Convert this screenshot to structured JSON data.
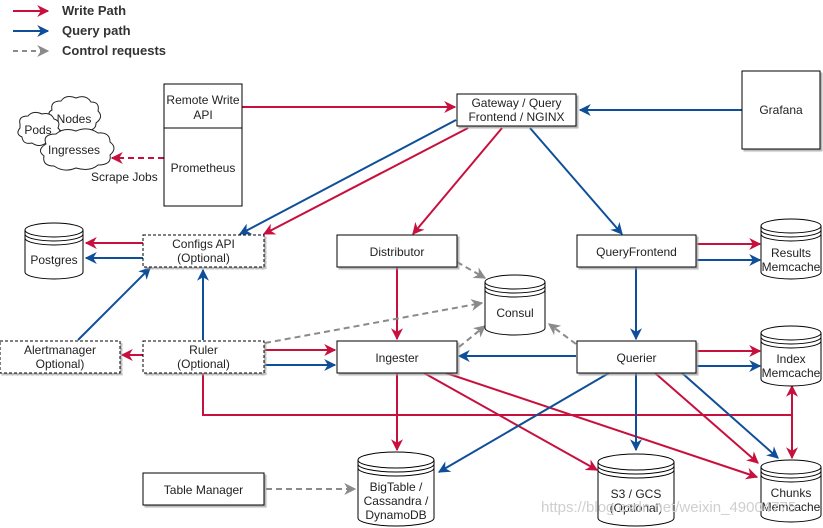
{
  "colors": {
    "write": "#c8103e",
    "query": "#0f4f99",
    "control": "#8a8a8a",
    "box_stroke": "#000000",
    "box_fill": "#ffffff"
  },
  "legend": [
    {
      "kind": "write",
      "label": "Write Path"
    },
    {
      "kind": "query",
      "label": "Query path"
    },
    {
      "kind": "control",
      "label": "Control requests"
    }
  ],
  "nodes": {
    "remote_write": {
      "label": [
        "Remote Write",
        "API"
      ]
    },
    "prometheus": {
      "label": [
        "Prometheus"
      ]
    },
    "gateway": {
      "label": [
        "Gateway / Query",
        "Frontend / NGINX"
      ]
    },
    "grafana": {
      "label": [
        "Grafana"
      ]
    },
    "configs_api": {
      "label": [
        "Configs API",
        "(Optional)"
      ]
    },
    "postgres": {
      "label": [
        "Postgres"
      ]
    },
    "distributor": {
      "label": [
        "Distributor"
      ]
    },
    "consul": {
      "label": [
        "Consul"
      ]
    },
    "query_frontend": {
      "label": [
        "QueryFrontend"
      ]
    },
    "results_memcache": {
      "label": [
        "Results",
        "Memcache"
      ]
    },
    "alertmanager": {
      "label": [
        "Alertmanager",
        "Optional)"
      ]
    },
    "ruler": {
      "label": [
        "Ruler",
        "(Optional)"
      ]
    },
    "ingester": {
      "label": [
        "Ingester"
      ]
    },
    "querier": {
      "label": [
        "Querier"
      ]
    },
    "index_memcache": {
      "label": [
        "Index",
        "Memcache"
      ]
    },
    "table_manager": {
      "label": [
        "Table Manager"
      ]
    },
    "bigtable": {
      "label": [
        "BigTable /",
        "Cassandra /",
        "DynamoDB"
      ]
    },
    "s3": {
      "label": [
        "S3 / GCS",
        "(Optional)"
      ]
    },
    "chunks_memcache": {
      "label": [
        "Chunks",
        "Memcache"
      ]
    },
    "cloud_nodes": {
      "label": [
        "Nodes"
      ]
    },
    "cloud_pods": {
      "label": [
        "Pods"
      ]
    },
    "cloud_ingresses": {
      "label": [
        "Ingresses"
      ]
    }
  },
  "edge_labels": {
    "scrape_jobs": "Scrape Jobs"
  },
  "edges": [
    {
      "from": "remote_write",
      "to": "gateway",
      "kind": "write"
    },
    {
      "from": "grafana",
      "to": "gateway",
      "kind": "query"
    },
    {
      "from": "gateway",
      "to": "configs_api",
      "kind": "query"
    },
    {
      "from": "gateway",
      "to": "configs_api",
      "kind": "write"
    },
    {
      "from": "gateway",
      "to": "distributor",
      "kind": "write"
    },
    {
      "from": "gateway",
      "to": "query_frontend",
      "kind": "query"
    },
    {
      "from": "prometheus",
      "to": "cloud_ingresses",
      "kind": "write",
      "style": "dashed"
    },
    {
      "from": "configs_api",
      "to": "postgres",
      "kind": "write"
    },
    {
      "from": "configs_api",
      "to": "postgres",
      "kind": "query"
    },
    {
      "from": "alertmanager",
      "to": "configs_api",
      "kind": "query"
    },
    {
      "from": "ruler",
      "to": "configs_api",
      "kind": "query"
    },
    {
      "from": "ruler",
      "to": "alertmanager",
      "kind": "write"
    },
    {
      "from": "ruler",
      "to": "ingester",
      "kind": "write"
    },
    {
      "from": "ruler",
      "to": "ingester",
      "kind": "query"
    },
    {
      "from": "ruler",
      "to": "consul",
      "kind": "control"
    },
    {
      "from": "ruler",
      "to": "chunks_memcache",
      "kind": "write"
    },
    {
      "from": "distributor",
      "to": "ingester",
      "kind": "write"
    },
    {
      "from": "distributor",
      "to": "consul",
      "kind": "control"
    },
    {
      "from": "ingester",
      "to": "consul",
      "kind": "control"
    },
    {
      "from": "querier",
      "to": "consul",
      "kind": "control"
    },
    {
      "from": "query_frontend",
      "to": "results_memcache",
      "kind": "write"
    },
    {
      "from": "query_frontend",
      "to": "results_memcache",
      "kind": "query"
    },
    {
      "from": "query_frontend",
      "to": "querier",
      "kind": "query"
    },
    {
      "from": "querier",
      "to": "ingester",
      "kind": "query"
    },
    {
      "from": "querier",
      "to": "index_memcache",
      "kind": "write"
    },
    {
      "from": "querier",
      "to": "index_memcache",
      "kind": "query"
    },
    {
      "from": "querier",
      "to": "bigtable",
      "kind": "query"
    },
    {
      "from": "querier",
      "to": "s3",
      "kind": "query"
    },
    {
      "from": "querier",
      "to": "chunks_memcache",
      "kind": "write"
    },
    {
      "from": "querier",
      "to": "chunks_memcache",
      "kind": "query"
    },
    {
      "from": "ingester",
      "to": "bigtable",
      "kind": "write"
    },
    {
      "from": "ingester",
      "to": "s3",
      "kind": "write"
    },
    {
      "from": "ingester",
      "to": "chunks_memcache",
      "kind": "write"
    },
    {
      "from": "ruler",
      "to": "index_memcache",
      "kind": "write"
    },
    {
      "from": "table_manager",
      "to": "bigtable",
      "kind": "control"
    }
  ],
  "watermark": "https://blog.csdn.net/weixin_49004775"
}
